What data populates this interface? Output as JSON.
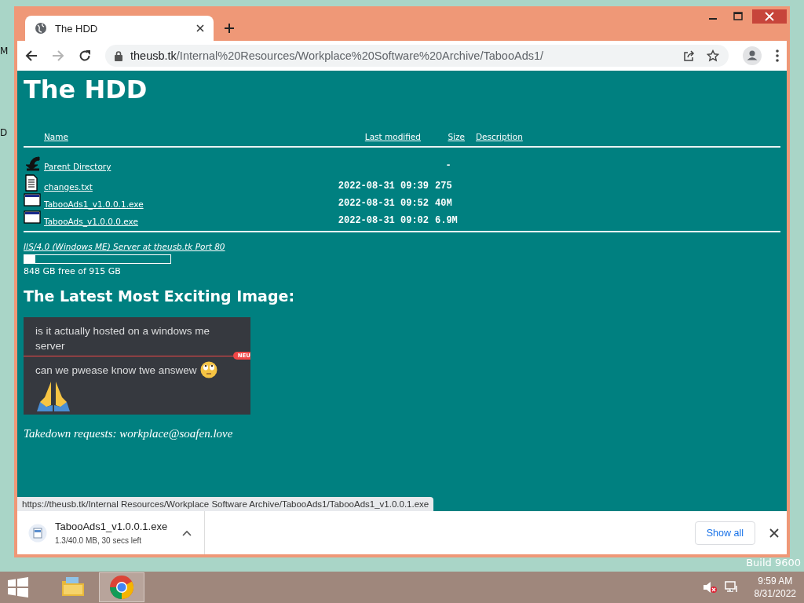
{
  "desktop": {
    "left_labels": [
      "M",
      "D"
    ],
    "build_text": "Build 9600"
  },
  "browser": {
    "tabs": [
      {
        "title": "The HDD",
        "selected": true
      }
    ],
    "address": {
      "host": "theusb.tk",
      "path": "/Internal%20Resources/Workplace%20Software%20Archive/TabooAds1/"
    }
  },
  "page": {
    "heading": "The HDD",
    "columns": [
      "Name",
      "Last modified",
      "Size",
      "Description"
    ],
    "rows": [
      {
        "kind": "parent",
        "name": "Parent Directory",
        "size": "-"
      },
      {
        "kind": "text",
        "name": "changes.txt",
        "modified": "2022-08-31 09:39",
        "size": "275"
      },
      {
        "kind": "exe",
        "name": "TabooAds1_v1.0.0.1.exe",
        "modified": "2022-08-31 09:52",
        "size": "40M"
      },
      {
        "kind": "exe",
        "name": "TabooAds_v1.0.0.0.exe",
        "modified": "2022-08-31 09:02",
        "size": "6.9M"
      }
    ],
    "server_line": "IIS/4.0 (Windows ME) Server at theusb.tk Port 80",
    "disk": {
      "level": 0.073,
      "text": "848 GB free of 915 GB"
    },
    "image_heading": "The Latest Most Exciting Image:",
    "chat": {
      "messages": [
        "is it actually hosted on a windows me server",
        "can we pwease know twe answew"
      ],
      "new_badge": "NEU"
    },
    "footer": "Takedown requests: workplace@soafen.love"
  },
  "status_url": "https://theusb.tk/Internal Resources/Workplace Software Archive/TabooAds1/TabooAds1_v1.0.0.1.exe",
  "download": {
    "filename": "TabooAds1_v1.0.0.1.exe",
    "progress_text": "1.3/40.0 MB, 30 secs left",
    "show_all": "Show all"
  },
  "taskbar": {
    "apps": [
      {
        "kind": "explorer",
        "selected": false
      },
      {
        "kind": "chrome",
        "selected": true
      }
    ],
    "time": "9:59 AM",
    "date": "8/31/2022"
  }
}
